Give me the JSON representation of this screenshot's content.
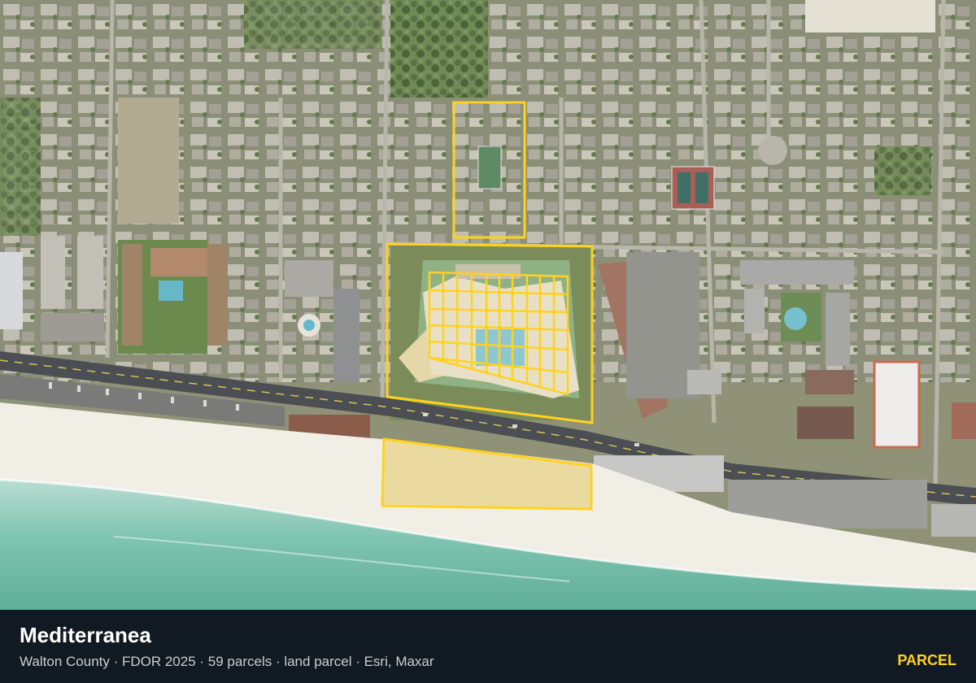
{
  "place": {
    "name": "Mediterranea"
  },
  "details": {
    "line": "Walton County · FDOR 2025 · 59 parcels · land parcel · Esri, Maxar"
  },
  "badge": "PARCEL",
  "colors": {
    "parcel_outline": "#ffd21f",
    "footer_bg": "#111a22",
    "gulf_water": "#7fc4b0",
    "beach_sand": "#f1eee6",
    "vegetation": "#6f8a55"
  },
  "map": {
    "imagery": "aerial satellite",
    "highlighted_parcels": 59
  }
}
